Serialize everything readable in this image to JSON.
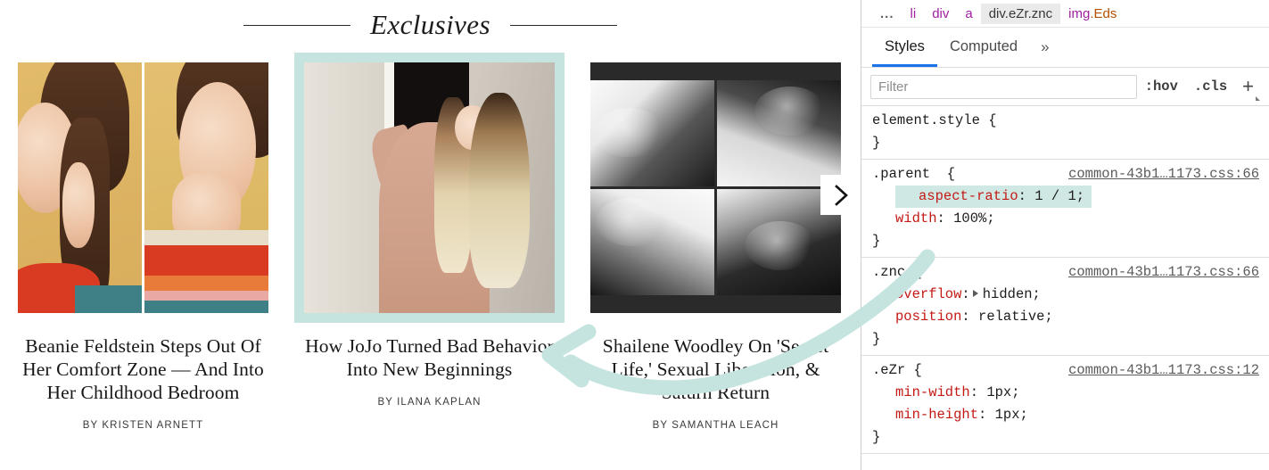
{
  "webpage": {
    "section_title": "Exclusives",
    "next_button_icon": "chevron-right-icon",
    "articles": [
      {
        "headline": "Beanie Feldstein Steps Out Of Her Comfort Zone — And Into Her Childhood Bedroom",
        "byline": "BY KRISTEN ARNETT",
        "image_alt": "two-panel-portrait-yellow-background",
        "selected": false
      },
      {
        "headline": "How JoJo Turned Bad Behavior Into New Beginnings",
        "byline": "BY ILANA KAPLAN",
        "image_alt": "blonde-woman-in-doorway-beige-outfit",
        "selected": true
      },
      {
        "headline": "Shailene Woodley On 'Secret Life,' Sexual Liberation, & Saturn Return",
        "byline": "BY SAMANTHA LEACH",
        "image_alt": "black-and-white-contact-sheet-grid",
        "selected": false
      }
    ]
  },
  "devtools": {
    "breadcrumb": [
      {
        "text": "...",
        "kind": "dots"
      },
      {
        "text": "li",
        "kind": "tag"
      },
      {
        "text": "div",
        "kind": "tag"
      },
      {
        "text": "a",
        "kind": "tag"
      },
      {
        "text": "div.eZr.znc",
        "kind": "selected"
      },
      {
        "text": "img.Eds",
        "kind": "tag-class"
      }
    ],
    "breadcrumb_selected_tag": "div",
    "breadcrumb_selected_classes": ".eZr.znc",
    "breadcrumb_last_tag": "img",
    "breadcrumb_last_classes": ".Eds",
    "tabs": [
      {
        "label": "Styles",
        "active": true
      },
      {
        "label": "Computed",
        "active": false
      }
    ],
    "more_tabs_icon": "chevron-double-right-icon",
    "filter": {
      "placeholder": "Filter",
      "value": ""
    },
    "toolbar": {
      "hov_label": ":hov",
      "cls_label": ".cls",
      "new_rule_label": "+"
    },
    "rules": [
      {
        "selector": "element.style",
        "source": "",
        "declarations": []
      },
      {
        "selector": ".parent",
        "source": "common-43b1…1173.css:66",
        "declarations": [
          {
            "property": "aspect-ratio",
            "value": "1 / 1",
            "highlighted": true,
            "expandable": false
          },
          {
            "property": "width",
            "value": "100%",
            "highlighted": false,
            "expandable": false
          }
        ]
      },
      {
        "selector": ".znc",
        "source": "common-43b1…1173.css:66",
        "declarations": [
          {
            "property": "overflow",
            "value": "hidden",
            "highlighted": false,
            "expandable": true
          },
          {
            "property": "position",
            "value": "relative",
            "highlighted": false,
            "expandable": false
          }
        ]
      },
      {
        "selector": ".eZr",
        "source": "common-43b1…1173.css:12",
        "declarations": [
          {
            "property": "min-width",
            "value": "1px",
            "highlighted": false,
            "expandable": false
          },
          {
            "property": "min-height",
            "value": "1px",
            "highlighted": false,
            "expandable": false
          }
        ]
      }
    ]
  },
  "annotation": {
    "arrow_color": "#c5e4e0",
    "arrow_description": "curved-arrow-pointing-left"
  },
  "colors": {
    "accent_blue": "#1a73e8",
    "highlight_mint": "#cfe8e3",
    "selection_outline": "#c5e4e0",
    "property_red": "#c41a16",
    "tag_purple": "#a020a0",
    "class_orange": "#b35000"
  }
}
